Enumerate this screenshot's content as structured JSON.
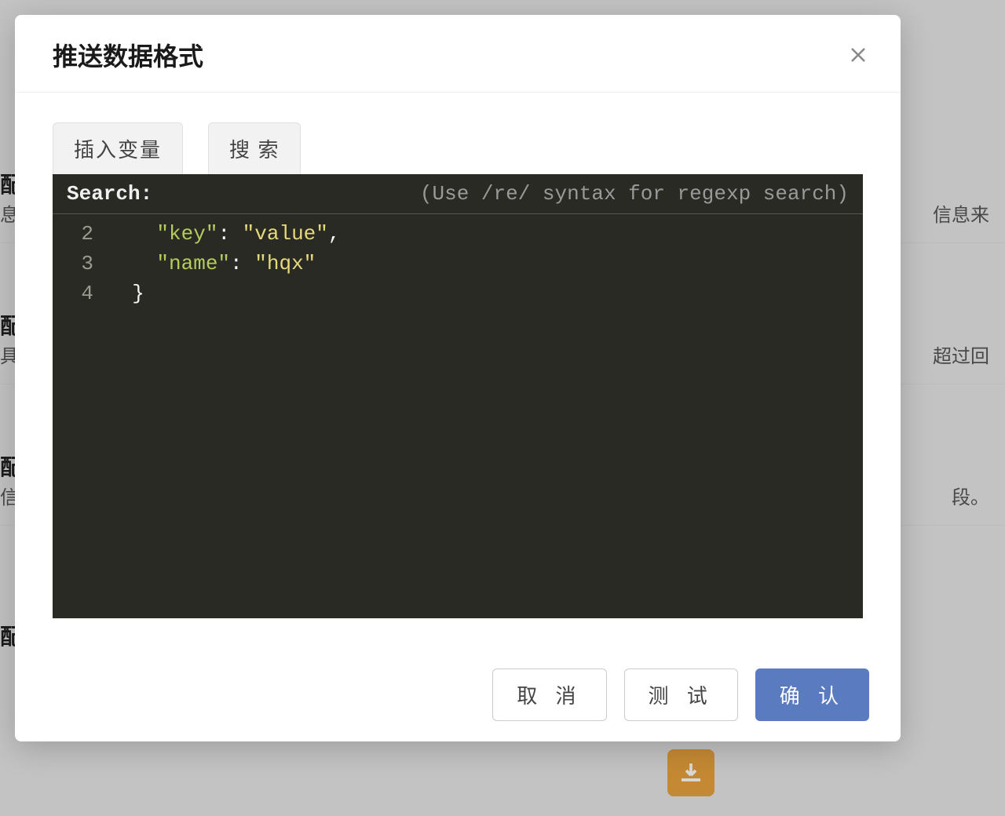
{
  "modal": {
    "title": "推送数据格式"
  },
  "tabs": {
    "insert_var": "插入变量",
    "search": "搜 索"
  },
  "editor": {
    "search_label": "Search:",
    "search_hint": "(Use /re/ syntax for regexp search)",
    "search_value": "",
    "gutter": [
      "2",
      "3",
      "4"
    ],
    "lines": [
      {
        "indent": "    ",
        "key": "\"key\"",
        "colon": ": ",
        "value": "\"value\"",
        "tail": ","
      },
      {
        "indent": "    ",
        "key": "\"name\"",
        "colon": ": ",
        "value": "\"hqx\"",
        "tail": ""
      },
      {
        "indent": "  ",
        "brace": "}"
      }
    ]
  },
  "footer": {
    "cancel": "取 消",
    "test": "测 试",
    "confirm": "确 认"
  },
  "background": {
    "row1_left": "配",
    "row1_left2": "息",
    "row1_right": "信息来",
    "row2_left": "配",
    "row2_left2": "具",
    "row2_right": "超过回",
    "row3_left": "配",
    "row3_left2": "信",
    "row3_right": "段。",
    "row4_left": "配"
  }
}
